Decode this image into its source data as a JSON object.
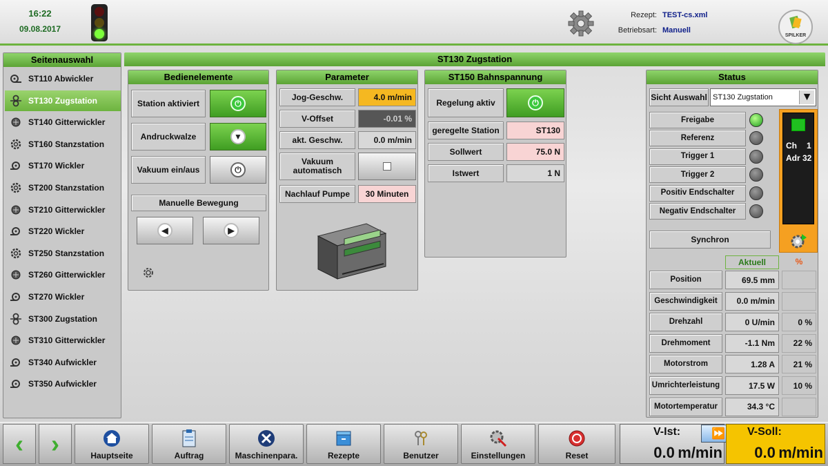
{
  "header": {
    "time": "16:22",
    "date": "09.08.2017",
    "recipe_label": "Rezept:",
    "recipe_value": "TEST-cs.xml",
    "mode_label": "Betriebsart:",
    "mode_value": "Manuell",
    "logo_text": "SPILKER",
    "traffic_light": {
      "red": false,
      "yellow": false,
      "green": true
    }
  },
  "sidebar": {
    "title": "Seitenauswahl",
    "items": [
      {
        "label": "ST110 Abwickler",
        "icon": "unwinder-icon",
        "active": false
      },
      {
        "label": "ST130 Zugstation",
        "icon": "tension-icon",
        "active": true
      },
      {
        "label": "ST140 Gitterwickler",
        "icon": "grid-winder-icon",
        "active": false
      },
      {
        "label": "ST160 Stanzstation",
        "icon": "gear-icon",
        "active": false
      },
      {
        "label": "ST170 Wickler",
        "icon": "winder-icon",
        "active": false
      },
      {
        "label": "ST200 Stanzstation",
        "icon": "gear-icon",
        "active": false
      },
      {
        "label": "ST210 Gitterwickler",
        "icon": "grid-winder-icon",
        "active": false
      },
      {
        "label": "ST220 Wickler",
        "icon": "winder-icon",
        "active": false
      },
      {
        "label": "ST250 Stanzstation",
        "icon": "gear-icon",
        "active": false
      },
      {
        "label": "ST260 Gitterwickler",
        "icon": "grid-winder-icon",
        "active": false
      },
      {
        "label": "ST270 Wickler",
        "icon": "winder-icon",
        "active": false
      },
      {
        "label": "ST300 Zugstation",
        "icon": "tension-icon",
        "active": false
      },
      {
        "label": "ST310 Gitterwickler",
        "icon": "grid-winder-icon",
        "active": false
      },
      {
        "label": "ST340 Aufwickler",
        "icon": "winder-icon",
        "active": false
      },
      {
        "label": "ST350 Aufwickler",
        "icon": "winder-icon",
        "active": false
      }
    ]
  },
  "main_title": "ST130 Zugstation",
  "bedien": {
    "title": "Bedienelemente",
    "station_label": "Station aktiviert",
    "andruck_label": "Andruckwalze",
    "vakuum_label": "Vakuum ein/aus",
    "manual_label": "Manuelle Bewegung"
  },
  "params": {
    "title": "Parameter",
    "rows": [
      {
        "label": "Jog-Geschw.",
        "value": "4.0 m/min"
      },
      {
        "label": "V-Offset",
        "value": "-0.01 %"
      },
      {
        "label": "akt. Geschw.",
        "value": "0.0 m/min"
      },
      {
        "label": "Vakuum automatisch",
        "value": ""
      },
      {
        "label": "Nachlauf Pumpe",
        "value": "30 Minuten"
      }
    ]
  },
  "bahn": {
    "title": "ST150 Bahnspannung",
    "regelung_label": "Regelung aktiv",
    "rows": [
      {
        "label": "geregelte Station",
        "value": "ST130"
      },
      {
        "label": "Sollwert",
        "value": "75.0 N"
      },
      {
        "label": "Istwert",
        "value": "1 N"
      }
    ]
  },
  "status": {
    "title": "Status",
    "sicht_label": "Sicht Auswahl",
    "sicht_value": "ST130 Zugstation",
    "signals": [
      {
        "label": "Freigabe",
        "on": true
      },
      {
        "label": "Referenz",
        "on": false
      },
      {
        "label": "Trigger 1",
        "on": false
      },
      {
        "label": "Trigger 2",
        "on": false
      },
      {
        "label": "Positiv Endschalter",
        "on": false
      },
      {
        "label": "Negativ Endschalter",
        "on": false
      }
    ],
    "synchron_label": "Synchron",
    "drive": {
      "ch_label": "Ch",
      "ch_value": "1",
      "adr_label": "Adr",
      "adr_value": "32"
    },
    "col_actual": "Aktuell",
    "col_percent": "%",
    "measures": [
      {
        "label": "Position",
        "value": "69.5 mm",
        "percent": ""
      },
      {
        "label": "Geschwindigkeit",
        "value": "0.0 m/min",
        "percent": ""
      },
      {
        "label": "Drehzahl",
        "value": "0 U/min",
        "percent": "0 %"
      },
      {
        "label": "Drehmoment",
        "value": "-1.1 Nm",
        "percent": "22 %"
      },
      {
        "label": "Motorstrom",
        "value": "1.28 A",
        "percent": "21 %"
      },
      {
        "label": "Umrichterleistung",
        "value": "17.5 W",
        "percent": "10 %"
      },
      {
        "label": "Motortemperatur",
        "value": "34.3 °C",
        "percent": ""
      }
    ]
  },
  "bottom": {
    "buttons": [
      "Hauptseite",
      "Auftrag",
      "Maschinenpara.",
      "Rezepte",
      "Benutzer",
      "Einstellungen",
      "Reset"
    ],
    "v_ist_label": "V-Ist:",
    "v_ist_value": "0.0 m/min",
    "v_soll_label": "V-Soll:",
    "v_soll_value": "0.0 m/min"
  },
  "colors": {
    "accent_green": "#6db33f",
    "value_orange": "#f5b821",
    "value_pink": "#f8d4d4",
    "soll_yellow": "#f5c400"
  }
}
